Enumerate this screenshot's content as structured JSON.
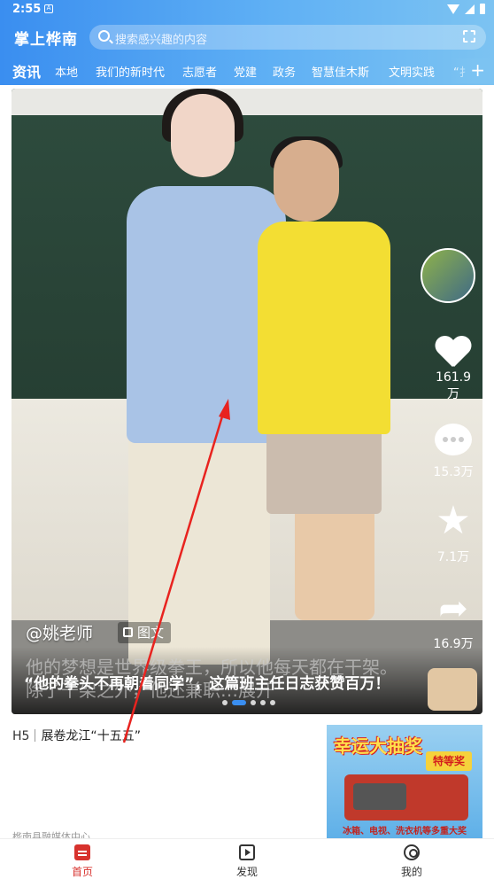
{
  "status_bar": {
    "time": "2:55",
    "notif_letter": "A"
  },
  "header": {
    "app_name": "掌上桦南",
    "search_placeholder": "搜索感兴趣的内容"
  },
  "tabs": [
    "资讯",
    "本地",
    "我们的新时代",
    "志愿者",
    "党建",
    "政务",
    "智慧佳木斯",
    "文明实践",
    "“扌"
  ],
  "active_tab": "资讯",
  "banner": {
    "author": "@姚老师",
    "type_tag": "图文",
    "overlay_text": "他的梦想是世界级拳王，所以他每天都在干架。除了干架之外，他还兼职…展开",
    "caption": "“他的拳头不再朝着同学”，这篇班主任日志获赞百万！",
    "stats": {
      "likes": "161.9万",
      "comments": "15.3万",
      "favorites": "7.1万",
      "shares": "16.9万"
    },
    "page_count": 5,
    "active_page": 1
  },
  "news": {
    "tag": "H5",
    "title": "展卷龙江“十五五”",
    "source": "桦南县融媒体中心",
    "thumb": {
      "headline": "幸运大抽奖",
      "badge": "特等奖",
      "footer": "冰箱、电视、洗衣机等多重大奖"
    }
  },
  "bottom_nav": [
    {
      "label": "首页",
      "icon": "home-icon"
    },
    {
      "label": "发现",
      "icon": "video-icon"
    },
    {
      "label": "我的",
      "icon": "profile-icon"
    }
  ],
  "colors": {
    "accent": "#3a8ef0",
    "nav_active": "#d7322d"
  }
}
